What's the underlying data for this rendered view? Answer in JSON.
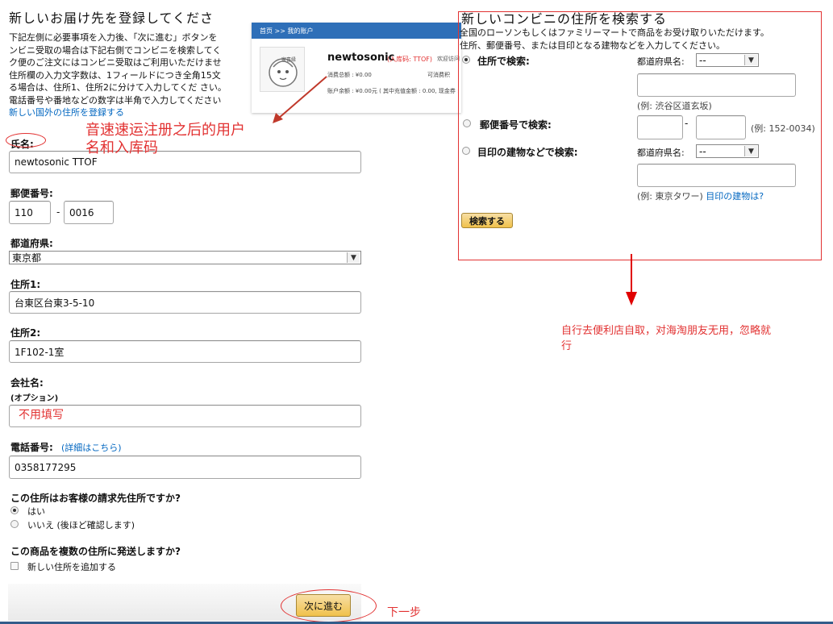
{
  "left": {
    "title": "新しいお届け先を登録してくださ",
    "paragraph": [
      "下記左側に必要事項を入力後、「次に進む」ボタンを",
      "ンビニ受取の場合は下記右側でコンビニを検索してく",
      "ク便のご注文にはコンビニ受取はご利用いただけませ",
      "住所欄の入力文字数は、1フィールドにつき全角15文",
      "る場合は、住所1、住所2に分けて入力してくだ さい。",
      "電話番号や番地などの数字は半角で入力してください"
    ],
    "intl_link": "新しい国外の住所を登録する",
    "name_label": "氏名:",
    "name_value": "newtosonic TTOF",
    "postal_label": "郵便番号:",
    "postal1": "110",
    "postal_sep": "-",
    "postal2": "0016",
    "pref_label": "都道府県:",
    "pref_value": "東京都",
    "addr1_label": "住所1:",
    "addr1_value": "台東区台東3-5-10",
    "addr2_label": "住所2:",
    "addr2_value": "1F102-1室",
    "company_label": "会社名:",
    "company_sub": "(オプション)",
    "phone_label": "電話番号:",
    "phone_detail_link": "(詳細はこちら)",
    "phone_value": "0358177295",
    "billing_question": "この住所はお客様の請求先住所ですか?",
    "billing_yes": "はい",
    "billing_no": "いいえ (後ほど確認します)",
    "multi_question": "この商品を複数の住所に発送しますか?",
    "multi_option": "新しい住所を追加する",
    "next_button": "次に進む"
  },
  "snippet": {
    "breadcrumb": "首页 >> 我的账户",
    "avatar_text": "家喜縁",
    "username": "newtosonic",
    "code": "(入库码: TTOF)",
    "welcome": "欢迎访问",
    "spent": "消费总额 : ¥0.00",
    "available": "可消费积",
    "balance": "账户余额 : ¥0.00元 ( 其中充值金额 : 0.00, 现金券 : 0"
  },
  "right": {
    "title": "新しいコンビニの住所を検索する",
    "paragraph": [
      "全国のローソンもしくはファミリーマートで商品をお受け取りいただけます。",
      "住所、郵便番号、または目印となる建物などを入力してください。"
    ],
    "opt_address": "住所で検索:",
    "pref_label": "都道府県名:",
    "pref_placeholder": "--",
    "address_example": "(例: 渋谷区道玄坂)",
    "opt_postal": "郵便番号で検索:",
    "postal_sep": "-",
    "postal_example": "(例: 152-0034)",
    "opt_landmark": "目印の建物などで検索:",
    "pref_label2": "都道府県名:",
    "pref_placeholder2": "--",
    "landmark_example": "(例: 東京タワー)",
    "landmark_help": "目印の建物は?",
    "search_button": "検索する"
  },
  "annotations": {
    "user_info": [
      "音速速运注册之后的用户",
      "名和入库码"
    ],
    "company_note": "不用填写",
    "conbini_note": [
      "自行去便利店自取，对海淘朋友无用，忽略就",
      "行"
    ],
    "next_note": "下一步"
  },
  "colors": {
    "annotation_red": "#e23232",
    "link_blue": "#0066c0",
    "button_yellow": "#f0c14b"
  }
}
